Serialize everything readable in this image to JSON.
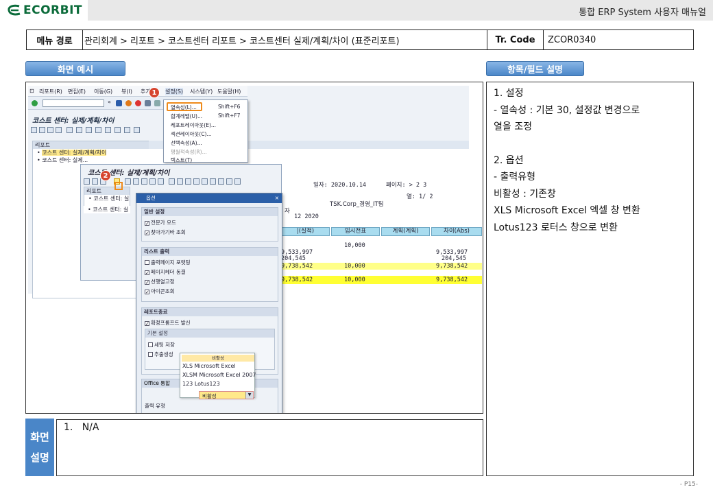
{
  "header": {
    "brand": "ECORBIT",
    "doc_title": "통합 ERP System 사용자 매뉴얼"
  },
  "path_row": {
    "menu_label": "메뉴 경로",
    "menu_path": "관리회계 > 리포트 > 코스트센터 리포트 > 코스트센터 실제/계획/차이 (표준리포트)",
    "tr_label": "Tr. Code",
    "tr_code": "ZCOR0340"
  },
  "tabs": {
    "example": "화면 예시",
    "fields": "항목/필드 설명"
  },
  "fields_panel": {
    "lines": [
      "1.  설정",
      " - 열속성 : 기본 30, 설정값 변경으로",
      "   열을 조정",
      "",
      "2. 옵션",
      " - 출력유형",
      "   비활성 : 기존창",
      "   XLS Microsoft Excel 엑셀 창 변환",
      "   Lotus123 로터스 창으로 변환"
    ]
  },
  "desc": {
    "label_top": "화면",
    "label_bottom": "설명",
    "text": "1.   N/A"
  },
  "page_number": "- P15-",
  "sap": {
    "menu": [
      "리포트(R)",
      "편집(E)",
      "이동(G)",
      "뷰(I)",
      "추가",
      "설정(S)",
      "시스템(Y)",
      "도움말(H)"
    ],
    "title": "코스트 센터: 실제/계획/차이",
    "tree_head": "리포트",
    "tree_items": [
      "코스트 센터: 실제/계획/차이",
      "코스트 센터: 실제..."
    ],
    "tree2_head": "리포트",
    "tree2_items": [
      "코스트 센터: 실",
      "코스트 센터: 실"
    ],
    "dropdown": [
      {
        "label": "열속성(L)...",
        "shortcut": "Shift+F6"
      },
      {
        "label": "합계레벨(U)...",
        "shortcut": "Shift+F7"
      },
      {
        "label": "레포트레이아웃(E)...",
        "shortcut": ""
      },
      {
        "label": "섹션레이아웃(C)...",
        "shortcut": ""
      },
      {
        "label": "선택속성(A)...",
        "shortcut": ""
      },
      {
        "label": "평월적속성(R)...",
        "shortcut": ""
      },
      {
        "label": "텍스트(T)",
        "shortcut": ""
      }
    ],
    "win2_title": "코스트 센터: 실제/계획/차이",
    "report_date": "일자: 2020.10.14",
    "report_page": "페이지:  >  2    3",
    "report_col": "열:   1/   2",
    "report_org": "TSK.Corp_경영_IT팀",
    "report_sub": "자",
    "report_period": "12  2020",
    "table": {
      "headers": [
        "|(실적)",
        "임시전표",
        "계획(계획)",
        "차이(Abs)"
      ],
      "col1": [
        "9,533,997",
        "204,545",
        "9,738,542",
        "9,738,542"
      ],
      "col2": [
        "10,000",
        "10,000",
        "10,000"
      ],
      "col4": [
        "9,533,997",
        "204,545",
        "9,738,542",
        "9,738,542"
      ]
    },
    "options": {
      "title": "옵션",
      "close": "×",
      "groups": [
        {
          "head": "일반 설정",
          "items": [
            "전문가 모드",
            "찾아가기바 조회"
          ]
        },
        {
          "head": "리스트 출력",
          "items": [
            "출력페이지 포맷팅",
            "페이지헤더 동결",
            "선행열고정",
            "아이콘조회"
          ]
        },
        {
          "head": "레포트종료",
          "items": [
            "확정프롬프트 발신"
          ]
        }
      ],
      "sub_head": "기본 설정",
      "sub_items": [
        "세팅 저장",
        "추출생성"
      ],
      "office_head": "Office 통합",
      "output_label": "출력 유형",
      "output_value": "비활성",
      "popup_head": "비활성",
      "popup_items": [
        "XLS    Microsoft Excel",
        "XLSM Microsoft Excel 2007",
        "123    Lotus123"
      ]
    },
    "badges": [
      "1",
      "2"
    ]
  },
  "colors": {
    "tab_blue": "#4a86c8",
    "brand_green": "#0b6b3a",
    "highlight_orange": "#ee8a1a",
    "badge_red": "#d6452f"
  }
}
